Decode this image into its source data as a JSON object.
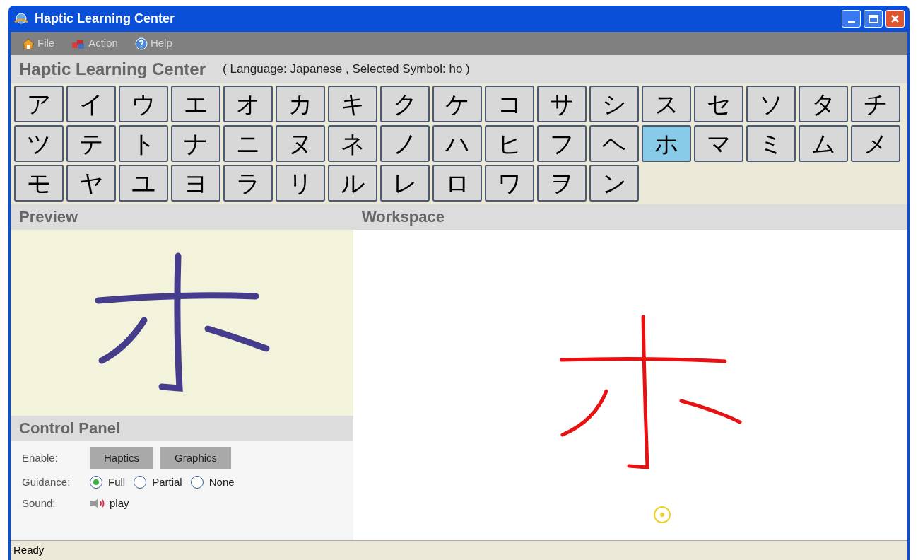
{
  "window": {
    "title": "Haptic Learning Center"
  },
  "menu": [
    {
      "label": "File",
      "kind": "home"
    },
    {
      "label": "Action",
      "kind": "action"
    },
    {
      "label": "Help",
      "kind": "help"
    }
  ],
  "header": {
    "title": "Haptic Learning Center",
    "subtitle": "( Language: Japanese , Selected Symbol: ho )"
  },
  "symbols": [
    {
      "char": "ア",
      "selected": false
    },
    {
      "char": "イ",
      "selected": false
    },
    {
      "char": "ウ",
      "selected": false
    },
    {
      "char": "エ",
      "selected": false
    },
    {
      "char": "オ",
      "selected": false
    },
    {
      "char": "カ",
      "selected": false
    },
    {
      "char": "キ",
      "selected": false
    },
    {
      "char": "ク",
      "selected": false
    },
    {
      "char": "ケ",
      "selected": false
    },
    {
      "char": "コ",
      "selected": false
    },
    {
      "char": "サ",
      "selected": false
    },
    {
      "char": "シ",
      "selected": false
    },
    {
      "char": "ス",
      "selected": false
    },
    {
      "char": "セ",
      "selected": false
    },
    {
      "char": "ソ",
      "selected": false
    },
    {
      "char": "タ",
      "selected": false
    },
    {
      "char": "チ",
      "selected": false
    },
    {
      "char": "ツ",
      "selected": false
    },
    {
      "char": "テ",
      "selected": false
    },
    {
      "char": "ト",
      "selected": false
    },
    {
      "char": "ナ",
      "selected": false
    },
    {
      "char": "ニ",
      "selected": false
    },
    {
      "char": "ヌ",
      "selected": false
    },
    {
      "char": "ネ",
      "selected": false
    },
    {
      "char": "ノ",
      "selected": false
    },
    {
      "char": "ハ",
      "selected": false
    },
    {
      "char": "ヒ",
      "selected": false
    },
    {
      "char": "フ",
      "selected": false
    },
    {
      "char": "ヘ",
      "selected": false
    },
    {
      "char": "ホ",
      "selected": true
    },
    {
      "char": "マ",
      "selected": false
    },
    {
      "char": "ミ",
      "selected": false
    },
    {
      "char": "ム",
      "selected": false
    },
    {
      "char": "メ",
      "selected": false
    },
    {
      "char": "モ",
      "selected": false
    },
    {
      "char": "ヤ",
      "selected": false
    },
    {
      "char": "ユ",
      "selected": false
    },
    {
      "char": "ヨ",
      "selected": false
    },
    {
      "char": "ラ",
      "selected": false
    },
    {
      "char": "リ",
      "selected": false
    },
    {
      "char": "ル",
      "selected": false
    },
    {
      "char": "レ",
      "selected": false
    },
    {
      "char": "ロ",
      "selected": false
    },
    {
      "char": "ワ",
      "selected": false
    },
    {
      "char": "ヲ",
      "selected": false
    },
    {
      "char": "ン",
      "selected": false
    }
  ],
  "preview": {
    "title": "Preview"
  },
  "workspace": {
    "title": "Workspace"
  },
  "control_panel": {
    "title": "Control Panel",
    "enable_label": "Enable:",
    "enable_buttons": [
      "Haptics",
      "Graphics"
    ],
    "guidance_label": "Guidance:",
    "guidance_options": [
      {
        "label": "Full",
        "selected": true
      },
      {
        "label": "Partial",
        "selected": false
      },
      {
        "label": "None",
        "selected": false
      }
    ],
    "sound_label": "Sound:",
    "sound_button": "play"
  },
  "status_bar": {
    "text": "Ready"
  }
}
